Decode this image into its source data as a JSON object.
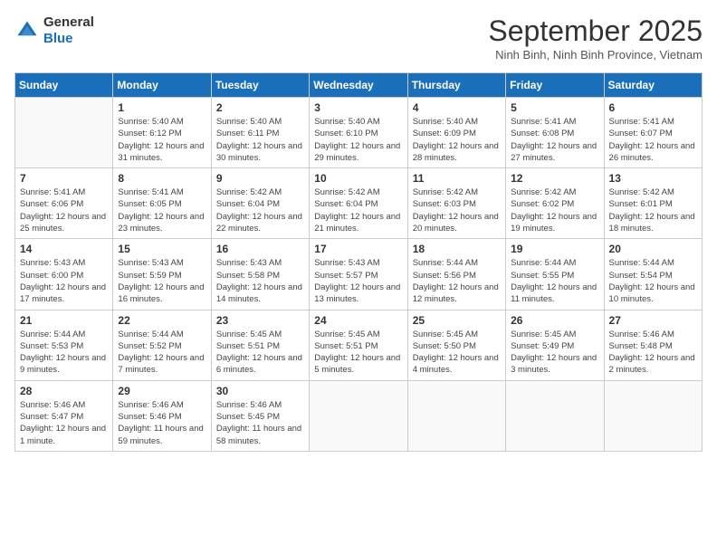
{
  "header": {
    "logo_general": "General",
    "logo_blue": "Blue",
    "month_title": "September 2025",
    "location": "Ninh Binh, Ninh Binh Province, Vietnam"
  },
  "columns": [
    "Sunday",
    "Monday",
    "Tuesday",
    "Wednesday",
    "Thursday",
    "Friday",
    "Saturday"
  ],
  "weeks": [
    [
      {
        "day": "",
        "sunrise": "",
        "sunset": "",
        "daylight": ""
      },
      {
        "day": "1",
        "sunrise": "Sunrise: 5:40 AM",
        "sunset": "Sunset: 6:12 PM",
        "daylight": "Daylight: 12 hours and 31 minutes."
      },
      {
        "day": "2",
        "sunrise": "Sunrise: 5:40 AM",
        "sunset": "Sunset: 6:11 PM",
        "daylight": "Daylight: 12 hours and 30 minutes."
      },
      {
        "day": "3",
        "sunrise": "Sunrise: 5:40 AM",
        "sunset": "Sunset: 6:10 PM",
        "daylight": "Daylight: 12 hours and 29 minutes."
      },
      {
        "day": "4",
        "sunrise": "Sunrise: 5:40 AM",
        "sunset": "Sunset: 6:09 PM",
        "daylight": "Daylight: 12 hours and 28 minutes."
      },
      {
        "day": "5",
        "sunrise": "Sunrise: 5:41 AM",
        "sunset": "Sunset: 6:08 PM",
        "daylight": "Daylight: 12 hours and 27 minutes."
      },
      {
        "day": "6",
        "sunrise": "Sunrise: 5:41 AM",
        "sunset": "Sunset: 6:07 PM",
        "daylight": "Daylight: 12 hours and 26 minutes."
      }
    ],
    [
      {
        "day": "7",
        "sunrise": "Sunrise: 5:41 AM",
        "sunset": "Sunset: 6:06 PM",
        "daylight": "Daylight: 12 hours and 25 minutes."
      },
      {
        "day": "8",
        "sunrise": "Sunrise: 5:41 AM",
        "sunset": "Sunset: 6:05 PM",
        "daylight": "Daylight: 12 hours and 23 minutes."
      },
      {
        "day": "9",
        "sunrise": "Sunrise: 5:42 AM",
        "sunset": "Sunset: 6:04 PM",
        "daylight": "Daylight: 12 hours and 22 minutes."
      },
      {
        "day": "10",
        "sunrise": "Sunrise: 5:42 AM",
        "sunset": "Sunset: 6:04 PM",
        "daylight": "Daylight: 12 hours and 21 minutes."
      },
      {
        "day": "11",
        "sunrise": "Sunrise: 5:42 AM",
        "sunset": "Sunset: 6:03 PM",
        "daylight": "Daylight: 12 hours and 20 minutes."
      },
      {
        "day": "12",
        "sunrise": "Sunrise: 5:42 AM",
        "sunset": "Sunset: 6:02 PM",
        "daylight": "Daylight: 12 hours and 19 minutes."
      },
      {
        "day": "13",
        "sunrise": "Sunrise: 5:42 AM",
        "sunset": "Sunset: 6:01 PM",
        "daylight": "Daylight: 12 hours and 18 minutes."
      }
    ],
    [
      {
        "day": "14",
        "sunrise": "Sunrise: 5:43 AM",
        "sunset": "Sunset: 6:00 PM",
        "daylight": "Daylight: 12 hours and 17 minutes."
      },
      {
        "day": "15",
        "sunrise": "Sunrise: 5:43 AM",
        "sunset": "Sunset: 5:59 PM",
        "daylight": "Daylight: 12 hours and 16 minutes."
      },
      {
        "day": "16",
        "sunrise": "Sunrise: 5:43 AM",
        "sunset": "Sunset: 5:58 PM",
        "daylight": "Daylight: 12 hours and 14 minutes."
      },
      {
        "day": "17",
        "sunrise": "Sunrise: 5:43 AM",
        "sunset": "Sunset: 5:57 PM",
        "daylight": "Daylight: 12 hours and 13 minutes."
      },
      {
        "day": "18",
        "sunrise": "Sunrise: 5:44 AM",
        "sunset": "Sunset: 5:56 PM",
        "daylight": "Daylight: 12 hours and 12 minutes."
      },
      {
        "day": "19",
        "sunrise": "Sunrise: 5:44 AM",
        "sunset": "Sunset: 5:55 PM",
        "daylight": "Daylight: 12 hours and 11 minutes."
      },
      {
        "day": "20",
        "sunrise": "Sunrise: 5:44 AM",
        "sunset": "Sunset: 5:54 PM",
        "daylight": "Daylight: 12 hours and 10 minutes."
      }
    ],
    [
      {
        "day": "21",
        "sunrise": "Sunrise: 5:44 AM",
        "sunset": "Sunset: 5:53 PM",
        "daylight": "Daylight: 12 hours and 9 minutes."
      },
      {
        "day": "22",
        "sunrise": "Sunrise: 5:44 AM",
        "sunset": "Sunset: 5:52 PM",
        "daylight": "Daylight: 12 hours and 7 minutes."
      },
      {
        "day": "23",
        "sunrise": "Sunrise: 5:45 AM",
        "sunset": "Sunset: 5:51 PM",
        "daylight": "Daylight: 12 hours and 6 minutes."
      },
      {
        "day": "24",
        "sunrise": "Sunrise: 5:45 AM",
        "sunset": "Sunset: 5:51 PM",
        "daylight": "Daylight: 12 hours and 5 minutes."
      },
      {
        "day": "25",
        "sunrise": "Sunrise: 5:45 AM",
        "sunset": "Sunset: 5:50 PM",
        "daylight": "Daylight: 12 hours and 4 minutes."
      },
      {
        "day": "26",
        "sunrise": "Sunrise: 5:45 AM",
        "sunset": "Sunset: 5:49 PM",
        "daylight": "Daylight: 12 hours and 3 minutes."
      },
      {
        "day": "27",
        "sunrise": "Sunrise: 5:46 AM",
        "sunset": "Sunset: 5:48 PM",
        "daylight": "Daylight: 12 hours and 2 minutes."
      }
    ],
    [
      {
        "day": "28",
        "sunrise": "Sunrise: 5:46 AM",
        "sunset": "Sunset: 5:47 PM",
        "daylight": "Daylight: 12 hours and 1 minute."
      },
      {
        "day": "29",
        "sunrise": "Sunrise: 5:46 AM",
        "sunset": "Sunset: 5:46 PM",
        "daylight": "Daylight: 11 hours and 59 minutes."
      },
      {
        "day": "30",
        "sunrise": "Sunrise: 5:46 AM",
        "sunset": "Sunset: 5:45 PM",
        "daylight": "Daylight: 11 hours and 58 minutes."
      },
      {
        "day": "",
        "sunrise": "",
        "sunset": "",
        "daylight": ""
      },
      {
        "day": "",
        "sunrise": "",
        "sunset": "",
        "daylight": ""
      },
      {
        "day": "",
        "sunrise": "",
        "sunset": "",
        "daylight": ""
      },
      {
        "day": "",
        "sunrise": "",
        "sunset": "",
        "daylight": ""
      }
    ]
  ]
}
